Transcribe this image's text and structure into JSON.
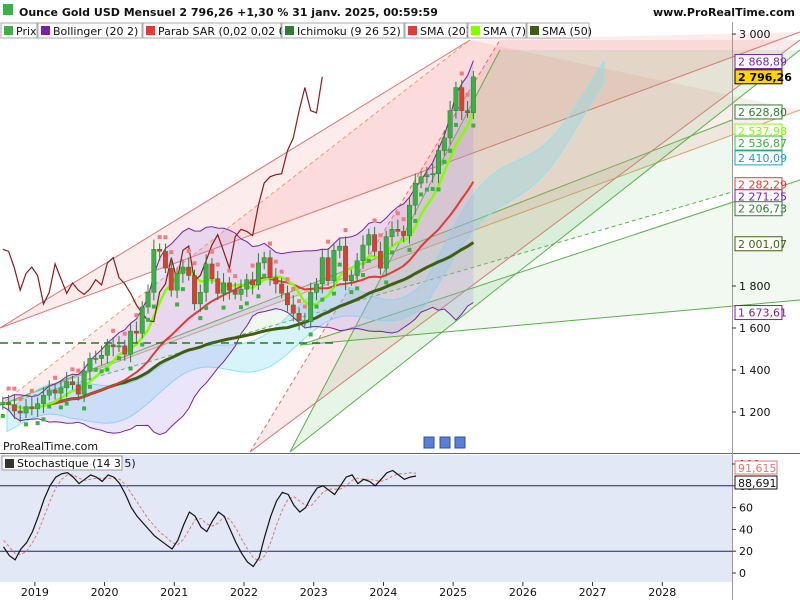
{
  "header": {
    "title": "Ounce Gold USD Mensuel 2 796,26 +1,30 % 31 janv. 2025, 00:59:59",
    "site": "www.ProRealTime.com"
  },
  "legend": [
    {
      "label": "Prix",
      "color": "#3cb043"
    },
    {
      "label": "Bollinger (20 2)",
      "color": "#7b1fa2"
    },
    {
      "label": "Parab SAR (0,02 0,02 0,2)",
      "color": "#e53935"
    },
    {
      "label": "Ichimoku (9 26 52)",
      "color": "#2e7d32"
    },
    {
      "label": "SMA (20)",
      "color": "#e53935"
    },
    {
      "label": "SMA (7)",
      "color": "#7fff00"
    },
    {
      "label": "SMA (50)",
      "color": "#3e5f0f"
    }
  ],
  "watermark": "ProRealTime.com",
  "chart_data": [
    {
      "type": "candlestick",
      "panel": "price",
      "y_scale": "linear",
      "ylim": [
        1000,
        3000
      ],
      "x_range": [
        "2018-06",
        "2028-12"
      ],
      "y_ticks": [
        "3 000",
        "1 800",
        "1 600",
        "1 400",
        "1 200"
      ],
      "x_ticks": [
        "2019",
        "2020",
        "2021",
        "2022",
        "2023",
        "2024",
        "2025",
        "2026",
        "2027",
        "2028"
      ],
      "last_price_label": "2 796,26",
      "price_tags": [
        {
          "text": "2 868,89",
          "value": 2868.89,
          "color": "#7b1fa2"
        },
        {
          "text": "2 796,26",
          "value": 2796.26,
          "color": "#000000",
          "highlight": true
        },
        {
          "text": "2 628,80",
          "value": 2628.8,
          "color": "#2e7d32"
        },
        {
          "text": "2 537,98",
          "value": 2537.98,
          "color": "#7fff00"
        },
        {
          "text": "2 536,87",
          "value": 2536.87,
          "color": "#3cb043"
        },
        {
          "text": "2 410,09",
          "value": 2410.09,
          "color": "#17a2b8"
        },
        {
          "text": "2 282,29",
          "value": 2282.29,
          "color": "#e53935"
        },
        {
          "text": "2 271,25",
          "value": 2271.25,
          "color": "#7b1fa2"
        },
        {
          "text": "2 206,73",
          "value": 2206.73,
          "color": "#2e7d32"
        },
        {
          "text": "2 001,07",
          "value": 2001.07,
          "color": "#3e5f0f"
        },
        {
          "text": "1 673,61",
          "value": 1673.61,
          "color": "#7b1fa2"
        }
      ],
      "close": [
        1245,
        1235,
        1205,
        1195,
        1225,
        1215,
        1240,
        1280,
        1305,
        1290,
        1315,
        1345,
        1330,
        1285,
        1395,
        1455,
        1455,
        1470,
        1520,
        1510,
        1515,
        1475,
        1585,
        1575,
        1700,
        1770,
        1975,
        1965,
        1885,
        1780,
        1860,
        1890,
        1850,
        1715,
        1770,
        1905,
        1835,
        1765,
        1815,
        1780,
        1760,
        1785,
        1830,
        1805,
        1910,
        1935,
        1840,
        1810,
        1765,
        1710,
        1670,
        1635,
        1630,
        1770,
        1810,
        1935,
        1825,
        1970,
        1990,
        1825,
        1850,
        1920,
        1995,
        2045,
        1965,
        1885,
        2035,
        2070,
        2060,
        2040,
        2185,
        2290,
        2320,
        2330,
        2335,
        2445,
        2505,
        2635,
        2745,
        2635,
        2625,
        2796
      ]
    },
    {
      "type": "line",
      "panel": "stochastic",
      "title": "Stochastique (14 3 5)",
      "ylim": [
        0,
        100
      ],
      "y_ticks": [
        "100",
        "80",
        "60",
        "40",
        "20",
        "0"
      ],
      "levels": [
        80,
        20
      ],
      "series": [
        {
          "name": "%K",
          "value_label": "88,691",
          "values": [
            24,
            16,
            12,
            22,
            28,
            38,
            52,
            68,
            80,
            88,
            91,
            92,
            88,
            82,
            86,
            90,
            88,
            84,
            90,
            88,
            82,
            72,
            60,
            52,
            46,
            40,
            34,
            30,
            26,
            22,
            30,
            44,
            56,
            52,
            42,
            38,
            48,
            56,
            52,
            40,
            28,
            18,
            10,
            6,
            14,
            34,
            52,
            66,
            74,
            72,
            62,
            56,
            60,
            70,
            78,
            80,
            76,
            72,
            80,
            88,
            90,
            82,
            86,
            84,
            80,
            86,
            92,
            94,
            90,
            86,
            88,
            89
          ]
        },
        {
          "name": "%D",
          "value_label": "91,615",
          "values": [
            30,
            24,
            18,
            17,
            20,
            28,
            38,
            52,
            66,
            78,
            86,
            90,
            90,
            87,
            85,
            86,
            87,
            87,
            87,
            87,
            86,
            81,
            73,
            65,
            57,
            49,
            43,
            37,
            33,
            28,
            26,
            31,
            40,
            49,
            50,
            45,
            43,
            46,
            52,
            49,
            41,
            31,
            22,
            14,
            11,
            16,
            28,
            44,
            58,
            68,
            70,
            66,
            62,
            62,
            68,
            74,
            77,
            77,
            77,
            80,
            85,
            87,
            86,
            86,
            85,
            84,
            86,
            89,
            91,
            91,
            92,
            91.6
          ]
        }
      ]
    }
  ]
}
